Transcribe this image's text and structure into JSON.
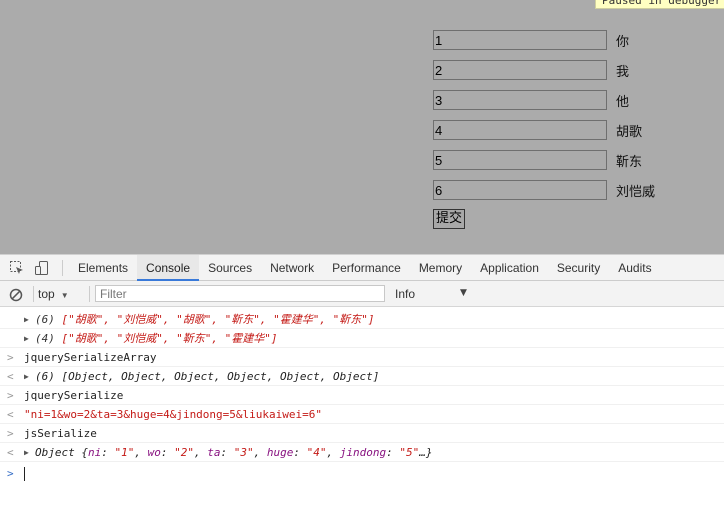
{
  "paused_badge": "Paused in debugger",
  "form": {
    "rows": [
      {
        "value": "1",
        "label": "你"
      },
      {
        "value": "2",
        "label": "我"
      },
      {
        "value": "3",
        "label": "他"
      },
      {
        "value": "4",
        "label": "胡歌"
      },
      {
        "value": "5",
        "label": "靳东"
      },
      {
        "value": "6",
        "label": "刘恺威"
      }
    ],
    "submit_label": "提交"
  },
  "devtools": {
    "tabs": [
      "Elements",
      "Console",
      "Sources",
      "Network",
      "Performance",
      "Memory",
      "Application",
      "Security",
      "Audits"
    ],
    "active_tab": "Console",
    "context": "top",
    "filter_placeholder": "Filter",
    "level": "Info"
  },
  "console": {
    "lines": [
      {
        "count": "(6)",
        "items": "[\"胡歌\", \"刘恺威\", \"胡歌\", \"靳东\", \"霍建华\", \"靳东\"]"
      },
      {
        "count": "(4)",
        "items": "[\"胡歌\", \"刘恺威\", \"靳东\", \"霍建华\"]"
      },
      {
        "input": "jquerySerializeArray"
      },
      {
        "count": "(6)",
        "items": "[Object, Object, Object, Object, Object, Object]"
      },
      {
        "input": "jquerySerialize"
      },
      {
        "result": "\"ni=1&wo=2&ta=3&huge=4&jindong=5&liukaiwei=6\""
      },
      {
        "input": "jsSerialize"
      },
      {
        "object_prefix": "Object {",
        "props": [
          {
            "key": "ni",
            "val": "\"1\""
          },
          {
            "key": "wo",
            "val": "\"2\""
          },
          {
            "key": "ta",
            "val": "\"3\""
          },
          {
            "key": "huge",
            "val": "\"4\""
          },
          {
            "key": "jindong",
            "val": "\"5\""
          }
        ],
        "object_suffix": "…}"
      }
    ]
  },
  "colors": {
    "page_overlay": "#ababab",
    "active_tab_underline": "#3879d9",
    "string_red": "#c41a16",
    "property_purple": "#881280",
    "prompt_blue": "#366ec6"
  }
}
